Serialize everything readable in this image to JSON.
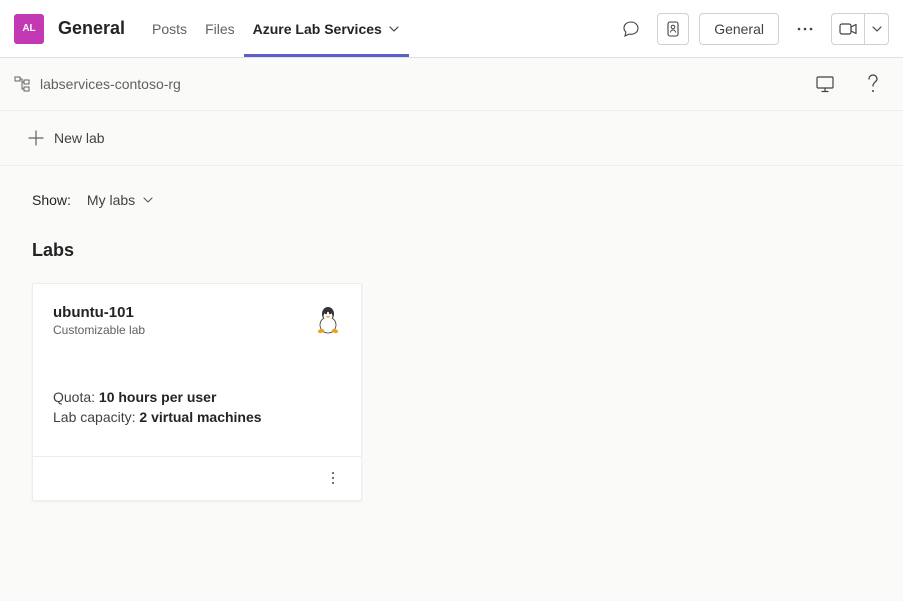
{
  "header": {
    "avatar_text": "AL",
    "channel_name": "General",
    "tabs": [
      {
        "label": "Posts"
      },
      {
        "label": "Files"
      },
      {
        "label": "Azure Lab Services"
      }
    ],
    "right_button_label": "General"
  },
  "subheader": {
    "breadcrumb": "labservices-contoso-rg"
  },
  "toolbar": {
    "new_lab_label": "New lab"
  },
  "filter": {
    "label": "Show:",
    "value": "My labs"
  },
  "section": {
    "title": "Labs"
  },
  "lab_card": {
    "title": "ubuntu-101",
    "subtitle": "Customizable lab",
    "quota_label": "Quota: ",
    "quota_value": "10 hours per user",
    "capacity_label": "Lab capacity: ",
    "capacity_value": "2 virtual machines"
  }
}
